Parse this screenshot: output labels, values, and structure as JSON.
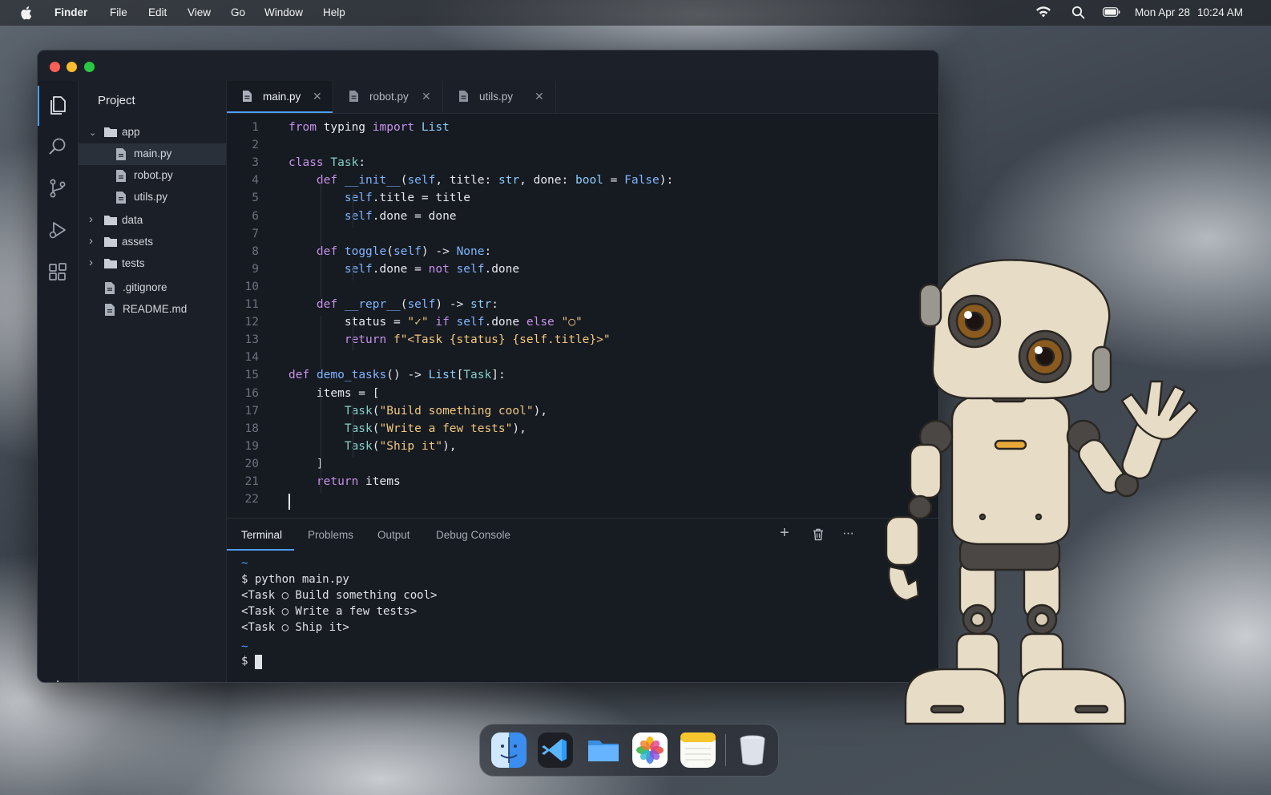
{
  "menubar": {
    "app_name": "Finder",
    "items": [
      "File",
      "Edit",
      "View",
      "Go",
      "Window",
      "Help"
    ],
    "date": "Mon Apr 28",
    "time": "10:24 AM"
  },
  "explorer": {
    "title": "Project",
    "tree": [
      {
        "label": "app",
        "type": "folder",
        "open": true
      },
      {
        "label": "main.py",
        "type": "file"
      },
      {
        "label": "robot.py",
        "type": "file"
      },
      {
        "label": "utils.py",
        "type": "file"
      },
      {
        "label": "data",
        "type": "folder",
        "open": false
      },
      {
        "label": "assets",
        "type": "folder",
        "open": false
      },
      {
        "label": "tests",
        "type": "folder",
        "open": false
      },
      {
        "label": ".gitignore",
        "type": "file"
      },
      {
        "label": "README.md",
        "type": "file"
      }
    ]
  },
  "tabs": [
    {
      "label": "main.py",
      "active": true
    },
    {
      "label": "robot.py",
      "active": false
    },
    {
      "label": "utils.py",
      "active": false
    }
  ],
  "code": {
    "line_numbers": [
      "1",
      "2",
      "3",
      "4",
      "5",
      "6",
      "7",
      "8",
      "9",
      "10",
      "11",
      "12",
      "13",
      "14",
      "15",
      "16",
      "17",
      "18",
      "19",
      "20",
      "21",
      "22"
    ],
    "lines": [
      "from typing import List",
      "",
      "class Task:",
      "    def __init__(self, title: str, done: bool = False):",
      "        self.title = title",
      "        self.done = done",
      "",
      "    def toggle(self) -> None:",
      "        self.done = not self.done",
      "",
      "    def __repr__(self) -> str:",
      "        status = \"✓\" if self.done else \"○\"",
      "        return f\"<Task {status} {self.title}>\"",
      "",
      "def demo_tasks() -> List[Task]:",
      "    items = [",
      "        Task(\"Build something cool\"),",
      "        Task(\"Write a few tests\"),",
      "        Task(\"Ship it\"),",
      "    ]",
      "    return items",
      ""
    ]
  },
  "panel": {
    "tabs": [
      "Terminal",
      "Problems",
      "Output",
      "Debug Console"
    ],
    "actions": {
      "add": "+",
      "more": "···"
    },
    "terminal": [
      {
        "text": "~",
        "kind": "tilde"
      },
      {
        "text": "$ python main.py",
        "kind": "cmd"
      },
      {
        "text": "<Task ○ Build something cool>",
        "kind": "out"
      },
      {
        "text": "<Task ○ Write a few tests>",
        "kind": "out"
      },
      {
        "text": "<Task ○ Ship it>",
        "kind": "out"
      },
      {
        "text": "~",
        "kind": "tilde"
      },
      {
        "text": "$ ",
        "kind": "cmd"
      }
    ]
  },
  "dock": {
    "apps": [
      "finder-icon",
      "vscode-icon",
      "files-folder-icon",
      "photos-icon",
      "notes-icon",
      "trash-icon"
    ]
  },
  "colors": {
    "accent": "#4d9fff",
    "keyword": "#c792ea",
    "string": "#f2c87e",
    "class": "#82d0c7",
    "function": "#7fb6ff",
    "editor_bg": "#161a21"
  }
}
